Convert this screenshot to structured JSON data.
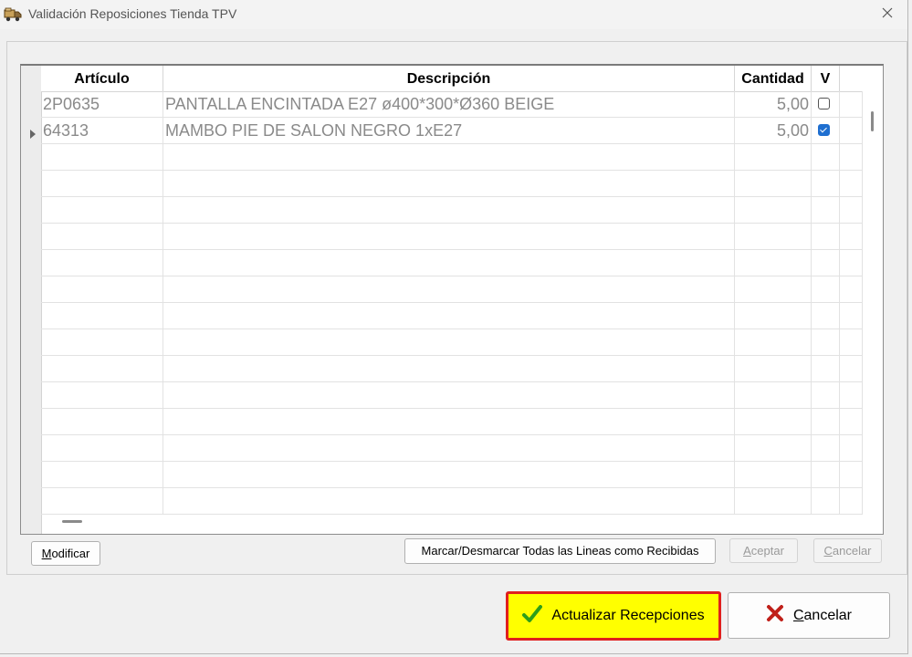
{
  "window": {
    "title": "Validación Reposiciones Tienda TPV",
    "icon": "truck-app-icon",
    "close_glyph": "✕"
  },
  "grid": {
    "columns": [
      "Artículo",
      "Descripción",
      "Cantidad",
      "V"
    ],
    "rows": [
      {
        "articulo": "2P0635",
        "descripcion": "PANTALLA ENCINTADA E27 ø400*300*Ø360 BEIGE",
        "cantidad": "5,00",
        "checked": false
      },
      {
        "articulo": "64313",
        "descripcion": "MAMBO PIE DE SALON NEGRO 1xE27",
        "cantidad": "5,00",
        "checked": true
      }
    ],
    "current_row": 2,
    "empty_rows": 14
  },
  "buttons": {
    "modificar": {
      "first": "M",
      "rest": "odificar"
    },
    "marcar_todas": "Marcar/Desmarcar Todas las Lineas como Recibidas",
    "aceptar": {
      "first": "A",
      "rest": "ceptar"
    },
    "cancelar_small": {
      "first": "C",
      "rest": "ancelar"
    },
    "actualizar": "Actualizar Recepciones",
    "cancelar_big": {
      "first": "C",
      "rest": "ancelar"
    }
  },
  "colors": {
    "highlight_fill": "#ffff00",
    "highlight_border": "#e0201e",
    "checkbox_checked": "#1f6fd0",
    "check_icon": "#2e9e1a",
    "cancel_icon": "#c0201a"
  }
}
